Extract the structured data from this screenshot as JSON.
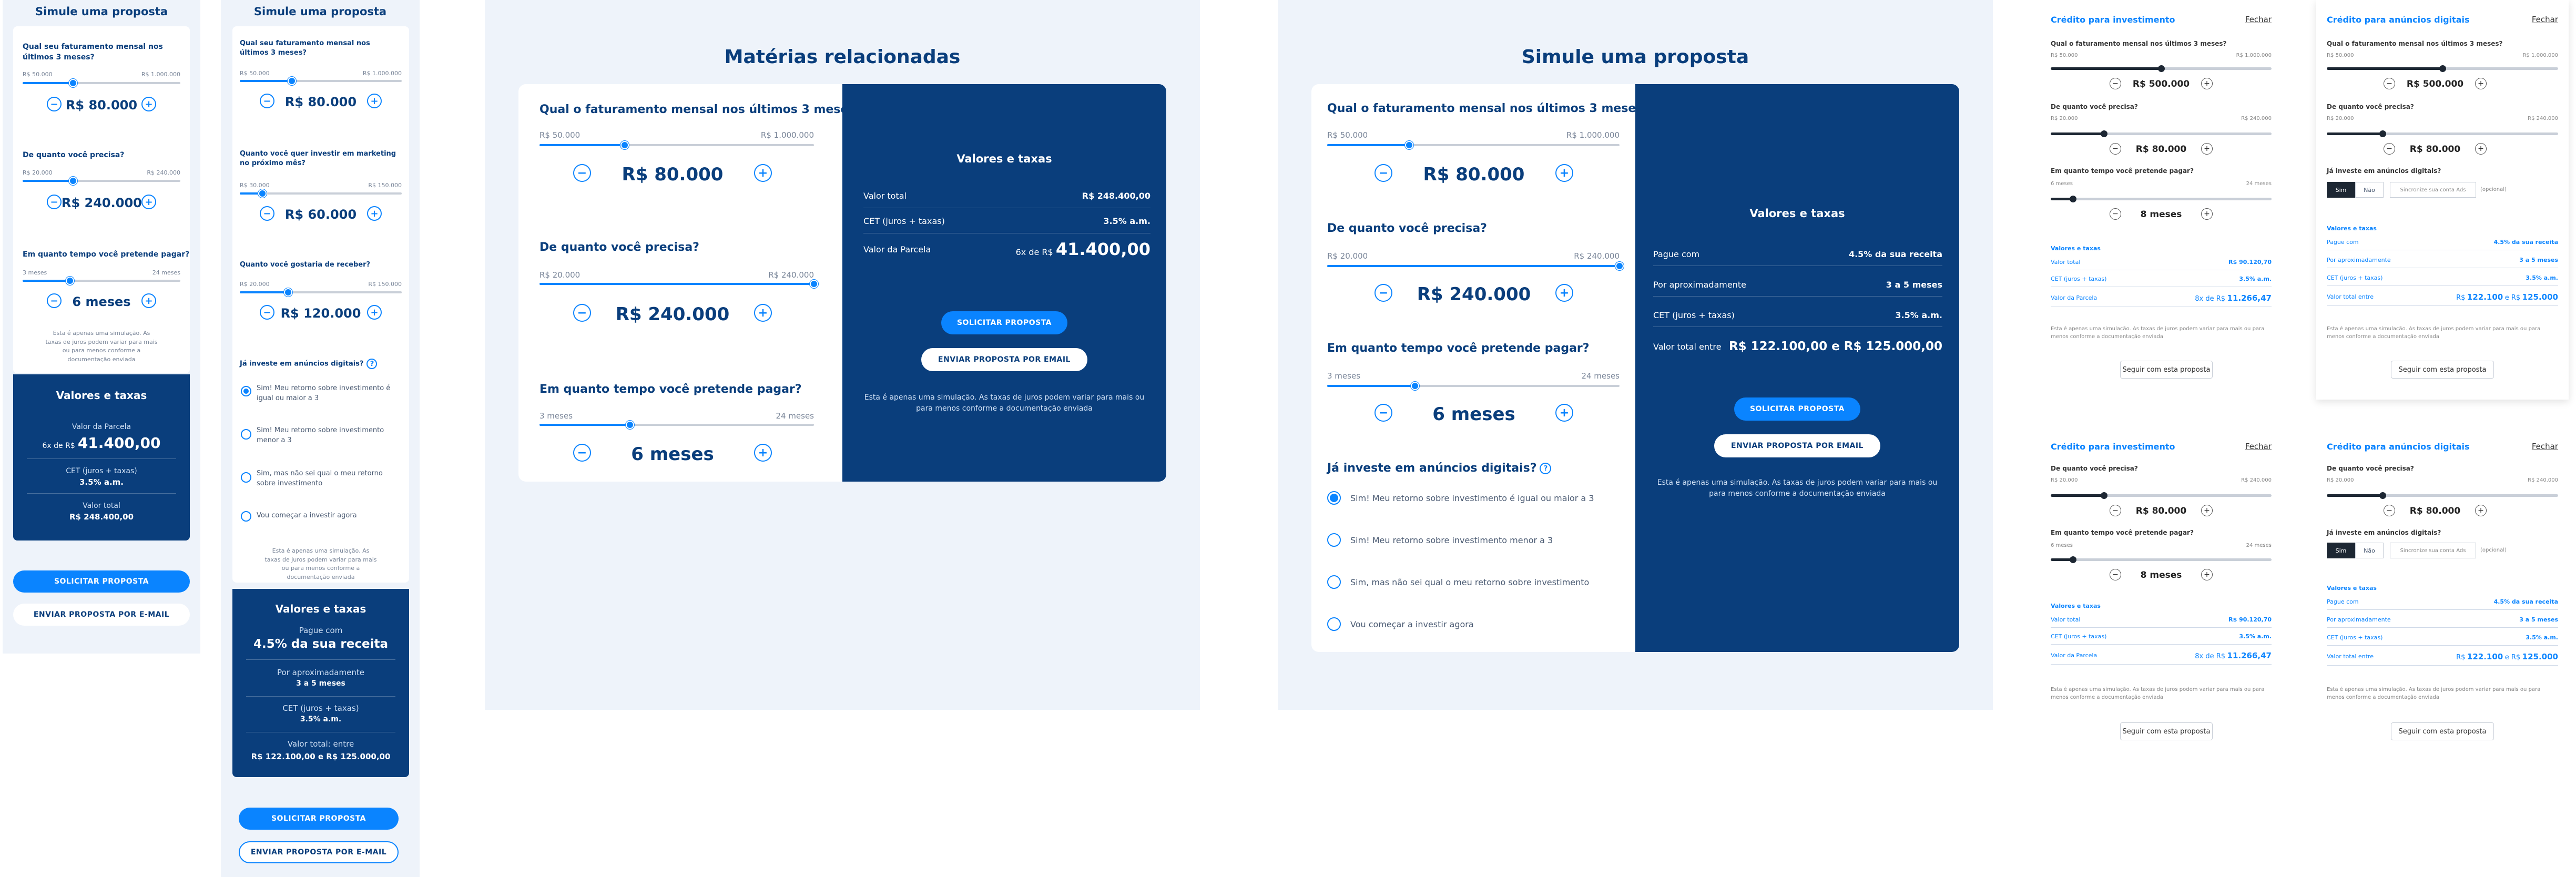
{
  "common": {
    "plus": "+",
    "minus": "−",
    "help": "?",
    "q_revenue": "Qual o faturamento mensal nos últimos 3 meses?",
    "q_amount": "De quanto você precisa?",
    "q_time": "Em quanto tempo você pretende pagar?",
    "q_ads": "Já investe em anúncios digitais?",
    "rev_min": "R$ 50.000",
    "rev_max": "R$ 1.000.000",
    "amt_min": "R$ 20.000",
    "amt_max": "R$ 240.000",
    "time_min": "3 meses",
    "time_max": "24 meses",
    "val_rev": "R$ 80.000",
    "val_amt": "R$ 240.000",
    "val_time": "6 meses",
    "note": "Esta é apenas uma simulação. As taxas de juros podem variar para mais ou para menos conforme a documentação enviada",
    "btn_request": "SOLICITAR PROPOSTA",
    "btn_email": "ENVIAR PROPOSTA POR EMAIL",
    "btn_email2": "ENVIAR PROPOSTA POR E-MAIL",
    "rates_title": "Valores e taxas",
    "parcela_label": "Valor da Parcela",
    "parcela_prefix": "6x de R$",
    "parcela_value": "41.400,00",
    "cet_label": "CET (juros + taxas)",
    "cet_value": "3.5% a.m.",
    "total_label": "Valor total",
    "total_value": "R$ 248.400,00",
    "opt1": "Sim! Meu retorno sobre investimento é igual ou maior a 3",
    "opt2": "Sim! Meu retorno sobre investimento menor a 3",
    "opt3": "Sim, mas não sei qual o meu retorno sobre investimento",
    "opt4": "Vou começar a investir agora",
    "pague_label": "Pague com",
    "pague_value": "4.5% da sua receita",
    "aprox_label": "Por aproximadamente",
    "aprox_value": "3 a 5 meses",
    "cet_label2": "CET (juros + taxas)",
    "total_between_label": "Valor total entre",
    "total_between_value": "R$ 122.100,00 e R$ 125.000,00",
    "total_between_label2": "Valor total: entre",
    "pague_value2": "4.5% da sua receita"
  },
  "m1": {
    "title": "Simule uma proposta",
    "q_revenue_short": "Qual seu faturamento mensal nos últimos 3 meses?",
    "rev_min": "R$ 50.000",
    "rev_max": "R$ 1.000.000",
    "val_rev": "R$ 80.000",
    "amt_min": "R$ 20.000",
    "amt_max": "R$ 240.000",
    "val_amt": "R$ 240.000",
    "time_min": "3 meses",
    "time_max": "24 meses",
    "val_time": "6 meses",
    "note": "Esta é apenas uma simulação. As taxas de juros podem variar para mais ou para menos conforme a documentação enviada"
  },
  "m2": {
    "title": "Simule uma proposta",
    "q_revenue_short": "Qual seu faturamento mensal nos últimos 3 meses?",
    "q_marketing": "Quanto você quer investir em marketing no próximo mês?",
    "q_receive": "Quanto você gostaria de receber?",
    "r1_min": "R$ 50.000",
    "r1_max": "R$ 1.000.000",
    "v1": "R$ 80.000",
    "r2_min": "R$ 30.000",
    "r2_max": "R$ 150.000",
    "v2": "R$ 60.000",
    "r3_min": "R$ 20.000",
    "r3_max": "R$ 150.000",
    "v3": "R$ 120.000",
    "q_ads": "Já investe em anúncios digitais?",
    "note": "Esta é apenas uma simulação. As taxas de juros podem variar para mais ou para menos conforme a documentação enviada",
    "pague_label": "Pague com",
    "pague_value": "4.5% da sua receita",
    "aprox_label": "Por aproximadamente",
    "aprox_value": "3 a 5 meses",
    "cet_label": "CET (juros + taxas)",
    "cet_value": "3.5% a.m.",
    "total_label": "Valor total: entre",
    "total_value": "R$ 122.100,00 e R$ 125.000,00"
  },
  "d1": {
    "heading": "Matérias relacionadas"
  },
  "d2": {
    "heading": "Simule uma proposta"
  },
  "s": {
    "credit_inv": "Crédito para investimento",
    "credit_ads": "Crédito para anúncios digitais",
    "close": "Fechar",
    "q_revenue_small": "Qual o faturamento mensal nos últimos 3 meses?",
    "q_amount_small": "De quanto você precisa?",
    "q_time_small": "Em quanto tempo você pretende pagar?",
    "q_ads_small": "Já investe em anúncios digitais?",
    "rev_min": "R$ 50.000",
    "rev_max": "R$ 1.000.000",
    "amt_min": "R$ 20.000",
    "amt_max": "R$ 240.000",
    "time_min": "6 meses",
    "time_max": "24 meses",
    "v500": "R$ 500.000",
    "v80": "R$ 80.000",
    "v8m": "8 meses",
    "seg_yes": "Sim",
    "seg_no": "Não",
    "seg_placeholder": "Sincronize sua conta Ads",
    "seg_optional": "(opcional)",
    "rates": "Valores e taxas",
    "total": "Valor total",
    "total_v": "R$ 90.120,70",
    "cet": "CET (juros + taxas)",
    "cet_v": "3.5% a.m.",
    "parcela": "Valor da Parcela",
    "parcela_v": "8x de R$",
    "parcela_big": "11.266,47",
    "pague": "Pague com",
    "pague_v": "4.5% da sua receita",
    "aprox": "Por aproximadamente",
    "aprox_v": "3 a 5 meses",
    "total_entre": "Valor total entre",
    "total_entre_v": "R$",
    "total_entre_big": "122.100",
    "total_entre_mid": "e R$",
    "total_entre_big2": "125.000",
    "note": "Esta é apenas uma simulação. As taxas de juros podem variar para mais ou para menos conforme a documentação enviada",
    "follow": "Seguir com esta proposta"
  },
  "sliders": {
    "m1_rev": 0.32,
    "m1_amt": 0.32,
    "m1_time": 0.3,
    "m2_r1": 0.32,
    "m2_r2": 0.14,
    "m2_r3": 0.3,
    "d1_rev": 0.31,
    "d1_amt": 1.0,
    "d1_time": 0.33,
    "d2_rev": 0.28,
    "d2_amt": 1.0,
    "d2_time": 0.3,
    "s_rev500": 0.5,
    "s_amt": 0.24,
    "s_time": 0.1
  }
}
